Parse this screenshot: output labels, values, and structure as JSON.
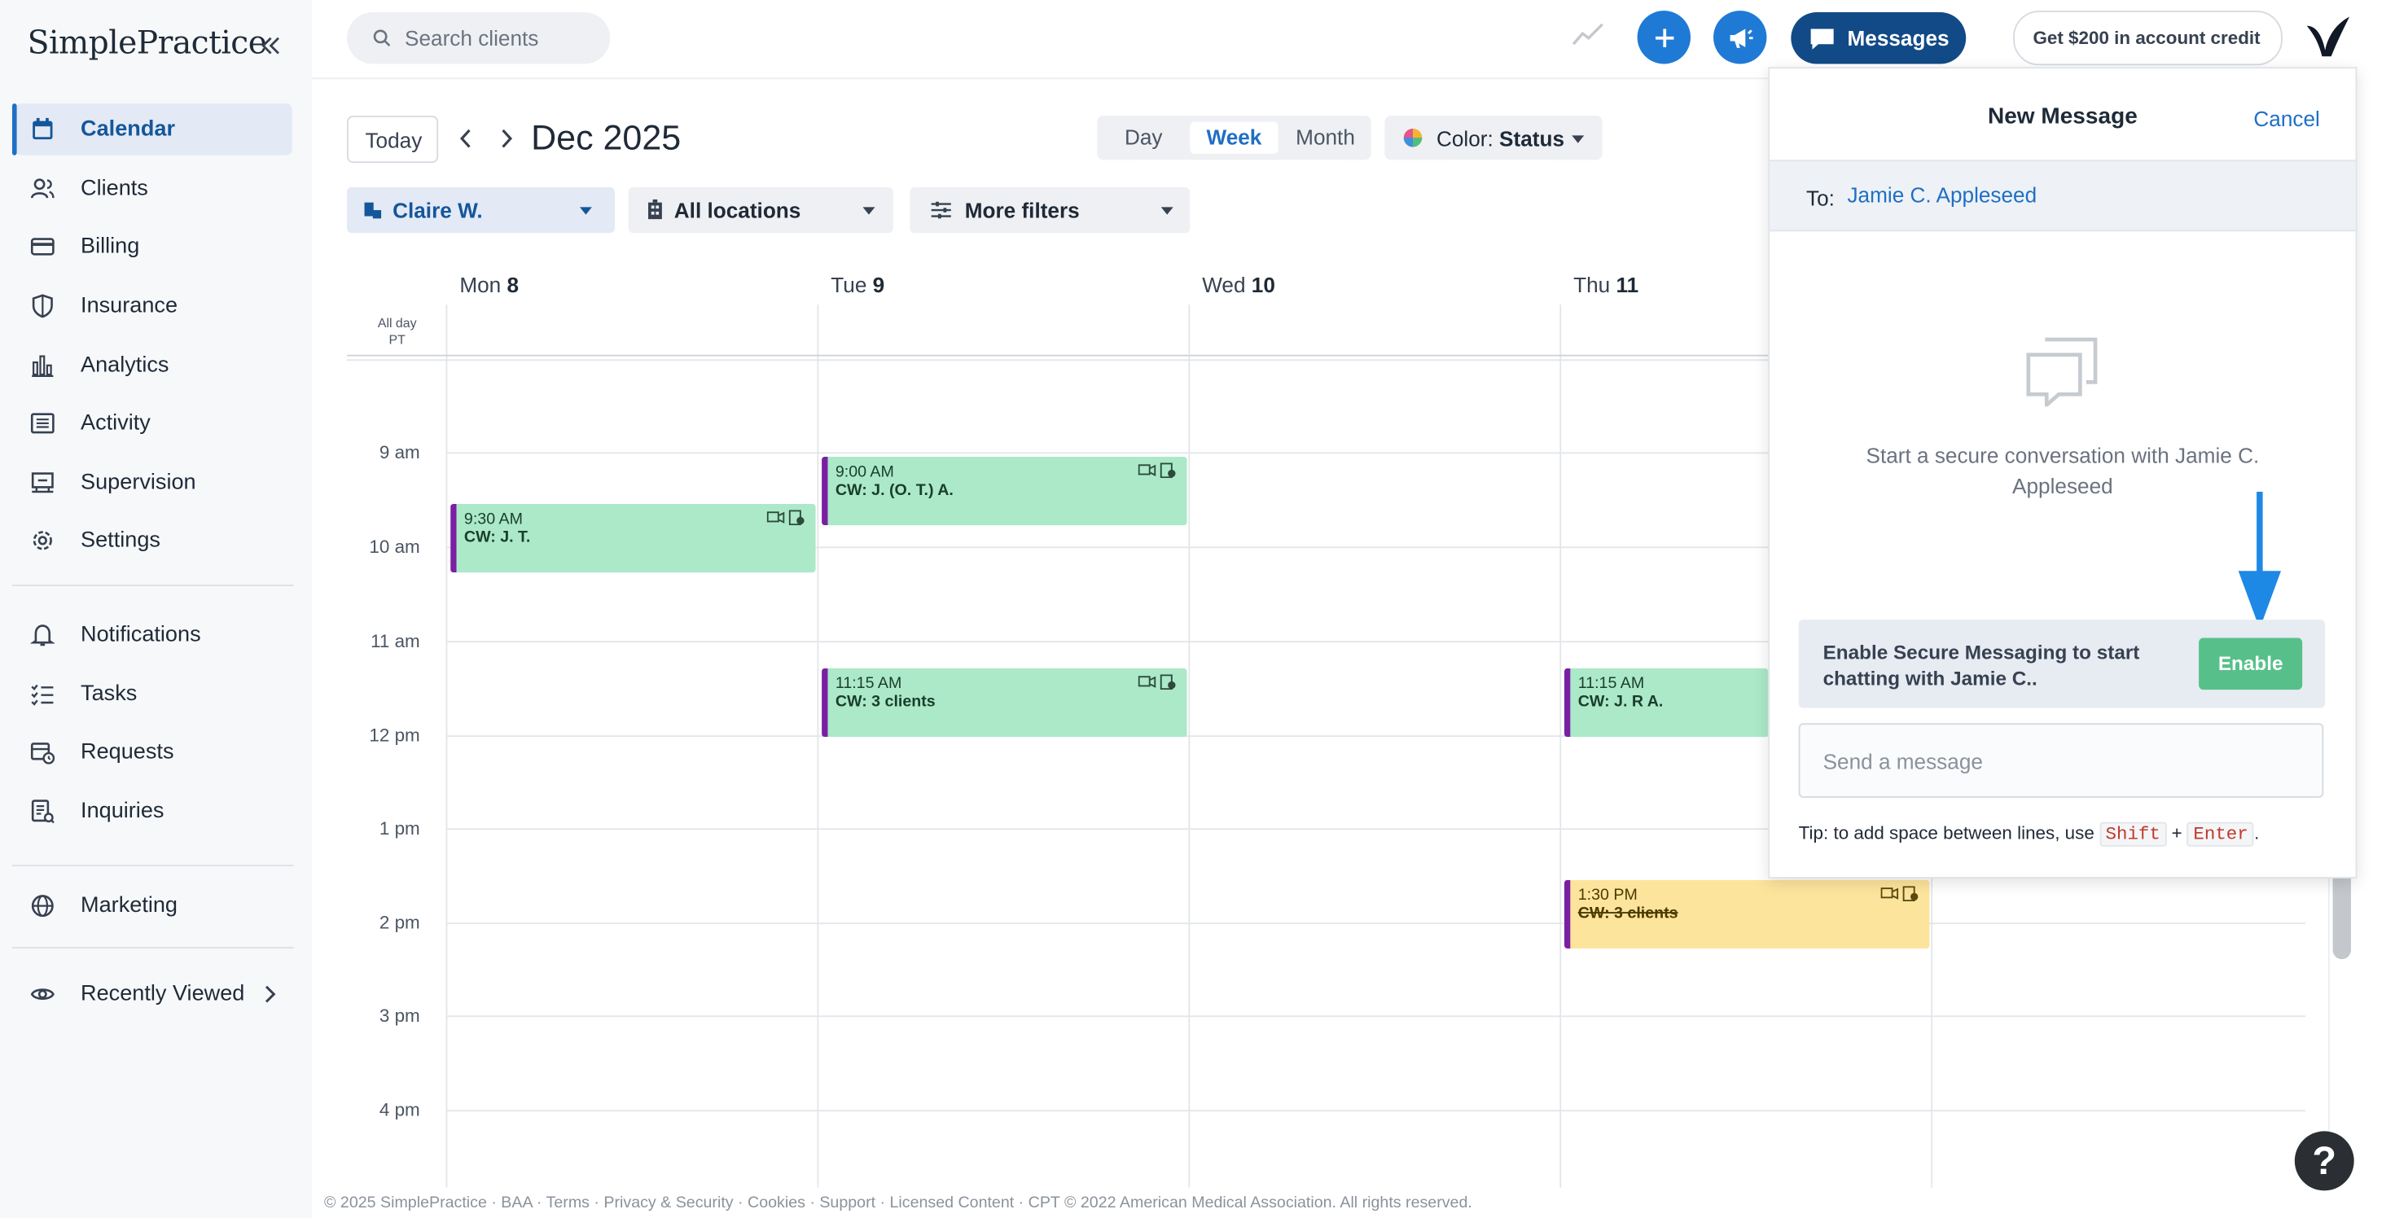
{
  "app": {
    "logo": "SimplePractice"
  },
  "sidebar": {
    "items": [
      {
        "label": "Calendar",
        "icon": "calendar-icon",
        "active": true
      },
      {
        "label": "Clients",
        "icon": "users-icon"
      },
      {
        "label": "Billing",
        "icon": "credit-card-icon"
      },
      {
        "label": "Insurance",
        "icon": "shield-icon"
      },
      {
        "label": "Analytics",
        "icon": "bar-chart-icon"
      },
      {
        "label": "Activity",
        "icon": "list-icon"
      },
      {
        "label": "Supervision",
        "icon": "supervision-icon"
      },
      {
        "label": "Settings",
        "icon": "gear-icon"
      },
      {
        "label": "Notifications",
        "icon": "bell-icon"
      },
      {
        "label": "Tasks",
        "icon": "checklist-icon"
      },
      {
        "label": "Requests",
        "icon": "calendar-clock-icon"
      },
      {
        "label": "Inquiries",
        "icon": "inquiry-icon"
      },
      {
        "label": "Marketing",
        "icon": "globe-icon"
      },
      {
        "label": "Recently Viewed",
        "icon": "eye-icon"
      }
    ]
  },
  "topbar": {
    "search_placeholder": "Search clients",
    "messages_label": "Messages",
    "credit_label": "Get $200 in account credit"
  },
  "toolbar": {
    "today_label": "Today",
    "month_title": "Dec 2025",
    "views": [
      "Day",
      "Week",
      "Month"
    ],
    "selected_view": "Week",
    "color_prefix": "Color:",
    "color_value": "Status",
    "filters": {
      "clinician": "Claire W.",
      "locations": "All locations",
      "more": "More filters"
    }
  },
  "calendar": {
    "days": [
      {
        "name": "Mon",
        "num": "8"
      },
      {
        "name": "Tue",
        "num": "9"
      },
      {
        "name": "Wed",
        "num": "10"
      },
      {
        "name": "Thu",
        "num": "11"
      }
    ],
    "allday_label": "All day",
    "timezone_label": "PT",
    "times": [
      "9 am",
      "10 am",
      "11 am",
      "12 pm",
      "1 pm",
      "2 pm",
      "3 pm",
      "4 pm"
    ],
    "events": [
      {
        "time": "9:30 AM",
        "name": "CW: J. T.",
        "color": "#abe9c9"
      },
      {
        "time": "9:00 AM",
        "name": "CW: J. (O. T.) A.",
        "color": "#abe9c9"
      },
      {
        "time": "11:15 AM",
        "name": "CW: 3 clients",
        "color": "#abe9c9"
      },
      {
        "time": "11:15 AM",
        "name": "CW: J. R A.",
        "color": "#abe9c9"
      },
      {
        "time": "1:30 PM",
        "name": "CW: 3 clients",
        "color": "#fde49c",
        "strikethrough": true
      }
    ]
  },
  "message_panel": {
    "title": "New Message",
    "cancel_label": "Cancel",
    "to_label": "To:",
    "recipient": "Jamie C. Appleseed",
    "empty_text": "Start a secure conversation with Jamie C. Appleseed",
    "enable_text": "Enable Secure Messaging to start chatting with Jamie C..",
    "enable_button": "Enable",
    "input_placeholder": "Send a message",
    "tip_prefix": "Tip: to add space between lines, use",
    "tip_key1": "Shift",
    "tip_plus": "+",
    "tip_key2": "Enter",
    "tip_suffix": "."
  },
  "help_label": "?",
  "footer": "© 2025 SimplePractice · BAA · Terms · Privacy & Security · Cookies · Support · Licensed Content · CPT © 2022 American Medical Association. All rights reserved.",
  "colors": {
    "accent": "#1f6fc5",
    "messages_button": "#114a87",
    "enable_button": "#57c08a",
    "event_border": "#7b1fa2"
  }
}
